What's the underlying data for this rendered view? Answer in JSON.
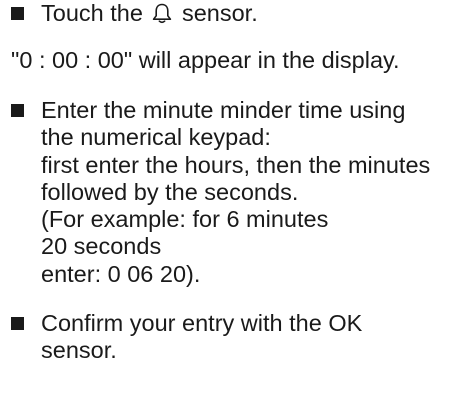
{
  "instructions": {
    "step1": {
      "before_icon": "Touch the",
      "icon": "bell-icon",
      "after_icon": "sensor."
    },
    "note": "\"0 : 00 : 00\" will appear in the display.",
    "step2": {
      "lines": [
        "Enter the minute minder time using",
        "the numerical keypad:",
        "first enter the hours, then the minutes",
        "followed by the seconds.",
        "(For example: for 6 minutes",
        "20 seconds",
        "enter: 0 06 20)."
      ]
    },
    "step3": {
      "lines": [
        "Confirm your entry with the OK",
        "sensor."
      ]
    }
  }
}
